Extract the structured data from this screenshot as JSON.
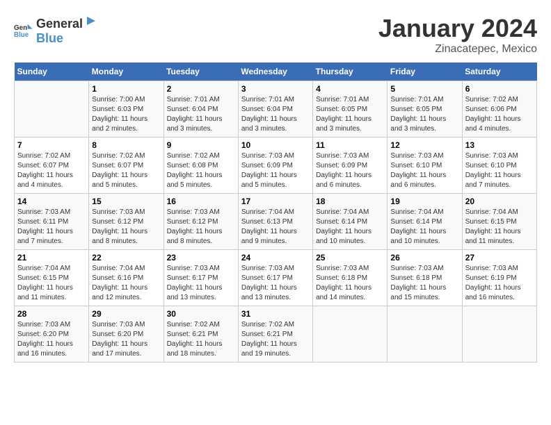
{
  "header": {
    "logo": {
      "general": "General",
      "blue": "Blue"
    },
    "month": "January 2024",
    "location": "Zinacatepec, Mexico"
  },
  "weekdays": [
    "Sunday",
    "Monday",
    "Tuesday",
    "Wednesday",
    "Thursday",
    "Friday",
    "Saturday"
  ],
  "weeks": [
    [
      null,
      {
        "day": 1,
        "sunrise": "7:00 AM",
        "sunset": "6:03 PM",
        "daylight": "11 hours and 2 minutes."
      },
      {
        "day": 2,
        "sunrise": "7:01 AM",
        "sunset": "6:04 PM",
        "daylight": "11 hours and 3 minutes."
      },
      {
        "day": 3,
        "sunrise": "7:01 AM",
        "sunset": "6:04 PM",
        "daylight": "11 hours and 3 minutes."
      },
      {
        "day": 4,
        "sunrise": "7:01 AM",
        "sunset": "6:05 PM",
        "daylight": "11 hours and 3 minutes."
      },
      {
        "day": 5,
        "sunrise": "7:01 AM",
        "sunset": "6:05 PM",
        "daylight": "11 hours and 3 minutes."
      },
      {
        "day": 6,
        "sunrise": "7:02 AM",
        "sunset": "6:06 PM",
        "daylight": "11 hours and 4 minutes."
      }
    ],
    [
      {
        "day": 7,
        "sunrise": "7:02 AM",
        "sunset": "6:07 PM",
        "daylight": "11 hours and 4 minutes."
      },
      {
        "day": 8,
        "sunrise": "7:02 AM",
        "sunset": "6:07 PM",
        "daylight": "11 hours and 5 minutes."
      },
      {
        "day": 9,
        "sunrise": "7:02 AM",
        "sunset": "6:08 PM",
        "daylight": "11 hours and 5 minutes."
      },
      {
        "day": 10,
        "sunrise": "7:03 AM",
        "sunset": "6:09 PM",
        "daylight": "11 hours and 5 minutes."
      },
      {
        "day": 11,
        "sunrise": "7:03 AM",
        "sunset": "6:09 PM",
        "daylight": "11 hours and 6 minutes."
      },
      {
        "day": 12,
        "sunrise": "7:03 AM",
        "sunset": "6:10 PM",
        "daylight": "11 hours and 6 minutes."
      },
      {
        "day": 13,
        "sunrise": "7:03 AM",
        "sunset": "6:10 PM",
        "daylight": "11 hours and 7 minutes."
      }
    ],
    [
      {
        "day": 14,
        "sunrise": "7:03 AM",
        "sunset": "6:11 PM",
        "daylight": "11 hours and 7 minutes."
      },
      {
        "day": 15,
        "sunrise": "7:03 AM",
        "sunset": "6:12 PM",
        "daylight": "11 hours and 8 minutes."
      },
      {
        "day": 16,
        "sunrise": "7:03 AM",
        "sunset": "6:12 PM",
        "daylight": "11 hours and 8 minutes."
      },
      {
        "day": 17,
        "sunrise": "7:04 AM",
        "sunset": "6:13 PM",
        "daylight": "11 hours and 9 minutes."
      },
      {
        "day": 18,
        "sunrise": "7:04 AM",
        "sunset": "6:14 PM",
        "daylight": "11 hours and 10 minutes."
      },
      {
        "day": 19,
        "sunrise": "7:04 AM",
        "sunset": "6:14 PM",
        "daylight": "11 hours and 10 minutes."
      },
      {
        "day": 20,
        "sunrise": "7:04 AM",
        "sunset": "6:15 PM",
        "daylight": "11 hours and 11 minutes."
      }
    ],
    [
      {
        "day": 21,
        "sunrise": "7:04 AM",
        "sunset": "6:15 PM",
        "daylight": "11 hours and 11 minutes."
      },
      {
        "day": 22,
        "sunrise": "7:04 AM",
        "sunset": "6:16 PM",
        "daylight": "11 hours and 12 minutes."
      },
      {
        "day": 23,
        "sunrise": "7:03 AM",
        "sunset": "6:17 PM",
        "daylight": "11 hours and 13 minutes."
      },
      {
        "day": 24,
        "sunrise": "7:03 AM",
        "sunset": "6:17 PM",
        "daylight": "11 hours and 13 minutes."
      },
      {
        "day": 25,
        "sunrise": "7:03 AM",
        "sunset": "6:18 PM",
        "daylight": "11 hours and 14 minutes."
      },
      {
        "day": 26,
        "sunrise": "7:03 AM",
        "sunset": "6:18 PM",
        "daylight": "11 hours and 15 minutes."
      },
      {
        "day": 27,
        "sunrise": "7:03 AM",
        "sunset": "6:19 PM",
        "daylight": "11 hours and 16 minutes."
      }
    ],
    [
      {
        "day": 28,
        "sunrise": "7:03 AM",
        "sunset": "6:20 PM",
        "daylight": "11 hours and 16 minutes."
      },
      {
        "day": 29,
        "sunrise": "7:03 AM",
        "sunset": "6:20 PM",
        "daylight": "11 hours and 17 minutes."
      },
      {
        "day": 30,
        "sunrise": "7:02 AM",
        "sunset": "6:21 PM",
        "daylight": "11 hours and 18 minutes."
      },
      {
        "day": 31,
        "sunrise": "7:02 AM",
        "sunset": "6:21 PM",
        "daylight": "11 hours and 19 minutes."
      },
      null,
      null,
      null
    ]
  ]
}
